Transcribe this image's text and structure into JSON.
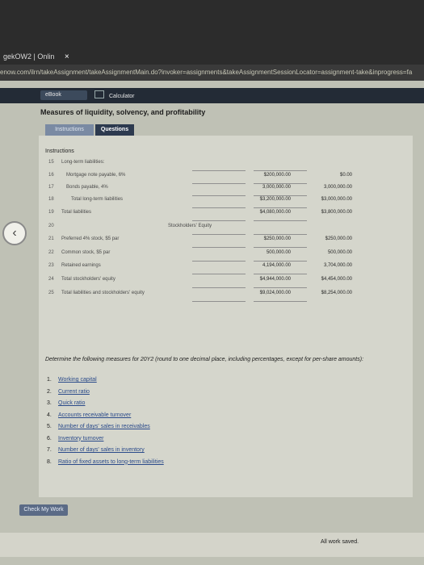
{
  "browser": {
    "tab_label": "gekOW2 | Onlin",
    "tab_close": "×",
    "url": "enow.com/ilrn/takeAssignment/takeAssignmentMain.do?invoker=assignments&takeAssignmentSessionLocator=assignment-take&inprogress=fa"
  },
  "toolbar": {
    "ebook_label": "eBook",
    "calculator_label": "Calculator"
  },
  "page": {
    "title": "Measures of liquidity, solvency, and profitability",
    "tabs": {
      "instructions": "Instructions",
      "questions": "Questions"
    }
  },
  "instructions_header": "Instructions",
  "balance": {
    "rows": [
      {
        "n": "15",
        "label": "Long-term liabilities:",
        "v1": "",
        "v2": ""
      },
      {
        "n": "16",
        "label": "Mortgage note payable, 6%",
        "v1": "$200,000.00",
        "v2": "$0.00"
      },
      {
        "n": "17",
        "label": "Bonds payable, 4%",
        "v1": "3,000,000.00",
        "v2": "3,000,000.00"
      },
      {
        "n": "18",
        "label": "Total long-term liabilities",
        "v1": "$3,200,000.00",
        "v2": "$3,000,000.00"
      },
      {
        "n": "19",
        "label": "Total liabilities",
        "v1": "$4,080,000.00",
        "v2": "$3,800,000.00"
      },
      {
        "n": "20",
        "label": "Stockholders' Equity",
        "v1": "",
        "v2": ""
      },
      {
        "n": "21",
        "label": "Preferred 4% stock, $5 par",
        "v1": "$250,000.00",
        "v2": "$250,000.00"
      },
      {
        "n": "22",
        "label": "Common stock, $5 par",
        "v1": "500,000.00",
        "v2": "500,000.00"
      },
      {
        "n": "23",
        "label": "Retained earnings",
        "v1": "4,194,000.00",
        "v2": "3,704,000.00"
      },
      {
        "n": "24",
        "label": "Total stockholders' equity",
        "v1": "$4,944,000.00",
        "v2": "$4,454,000.00"
      },
      {
        "n": "25",
        "label": "Total liabilities and stockholders' equity",
        "v1": "$9,024,000.00",
        "v2": "$8,254,000.00"
      }
    ]
  },
  "determine_text": "Determine the following measures for 20Y2 (round to one decimal place, including percentages, except for per-share amounts):",
  "measures": [
    {
      "n": "1.",
      "label": "Working capital"
    },
    {
      "n": "2.",
      "label": "Current ratio"
    },
    {
      "n": "3.",
      "label": "Quick ratio"
    },
    {
      "n": "4.",
      "label": "Accounts receivable turnover"
    },
    {
      "n": "5.",
      "label": "Number of days' sales in receivables"
    },
    {
      "n": "6.",
      "label": "Inventory turnover"
    },
    {
      "n": "7.",
      "label": "Number of days' sales in inventory"
    },
    {
      "n": "8.",
      "label": "Ratio of fixed assets to long-term liabilities"
    }
  ],
  "check_button": "Check My Work",
  "status": "All work saved.",
  "nav_arrow": "‹"
}
